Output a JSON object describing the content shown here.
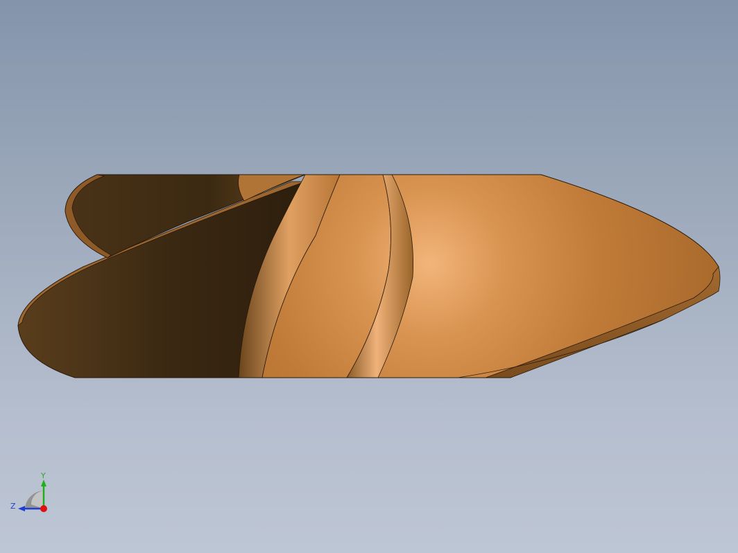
{
  "viewport": {
    "background_top": "#8494ab",
    "background_bottom": "#bdc6d4"
  },
  "model": {
    "part_color": "#c4803e",
    "shadow_color": "#3a2812",
    "highlight_color": "#f2b57a",
    "edge_color": "#2a1a0a"
  },
  "triad": {
    "y_label": "Y",
    "z_label": "Z",
    "y_color": "#1fb01f",
    "z_color": "#1f3fd0",
    "x_color": "#e01010",
    "y_label_color": "#2ea82e",
    "z_label_color": "#2740c8"
  }
}
